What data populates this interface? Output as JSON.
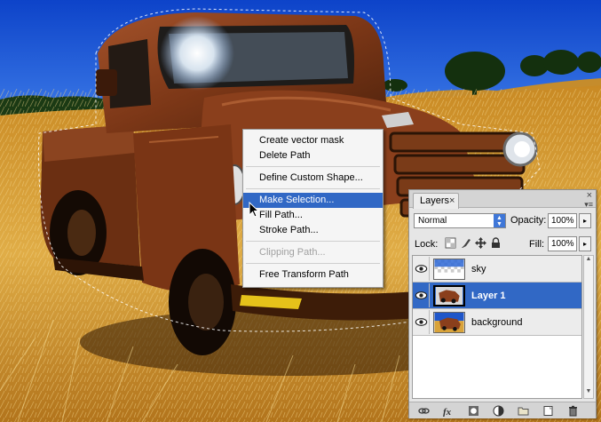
{
  "context_menu": {
    "items": [
      {
        "label": "Create vector mask",
        "state": "normal"
      },
      {
        "label": "Delete Path",
        "state": "normal"
      },
      {
        "label": "Define Custom Shape...",
        "state": "normal"
      },
      {
        "label": "Make Selection...",
        "state": "highlighted"
      },
      {
        "label": "Fill Path...",
        "state": "normal"
      },
      {
        "label": "Stroke Path...",
        "state": "normal"
      },
      {
        "label": "Clipping Path...",
        "state": "disabled"
      },
      {
        "label": "Free Transform Path",
        "state": "normal"
      }
    ]
  },
  "layers_panel": {
    "tab_label": "Layers",
    "tab_close": "×",
    "close_glyph": "×",
    "menu_glyph": "▾≡",
    "blend_mode": "Normal",
    "opacity_label": "Opacity:",
    "opacity_value": "100%",
    "lock_label": "Lock:",
    "fill_label": "Fill:",
    "fill_value": "100%",
    "stepper_glyph": "▸",
    "layers": [
      {
        "name": "sky",
        "visible": true,
        "selected": false,
        "thumb": "sky-transparent"
      },
      {
        "name": "Layer 1",
        "visible": true,
        "selected": true,
        "thumb": "truck"
      },
      {
        "name": "background",
        "visible": true,
        "selected": false,
        "thumb": "truck-scene"
      }
    ]
  },
  "colors": {
    "sky": "#1a56d8",
    "highlight": "#3168c5",
    "rust": "#8a3f1c",
    "grass": "#d9a33a"
  },
  "icons": [
    "cursor-arrow-icon",
    "eye-icon",
    "lock-transparent-icon",
    "lock-brush-icon",
    "lock-move-icon",
    "lock-all-icon",
    "link-icon",
    "fx-icon",
    "mask-icon",
    "adjustment-icon",
    "group-folder-icon",
    "new-layer-icon",
    "trash-icon"
  ]
}
